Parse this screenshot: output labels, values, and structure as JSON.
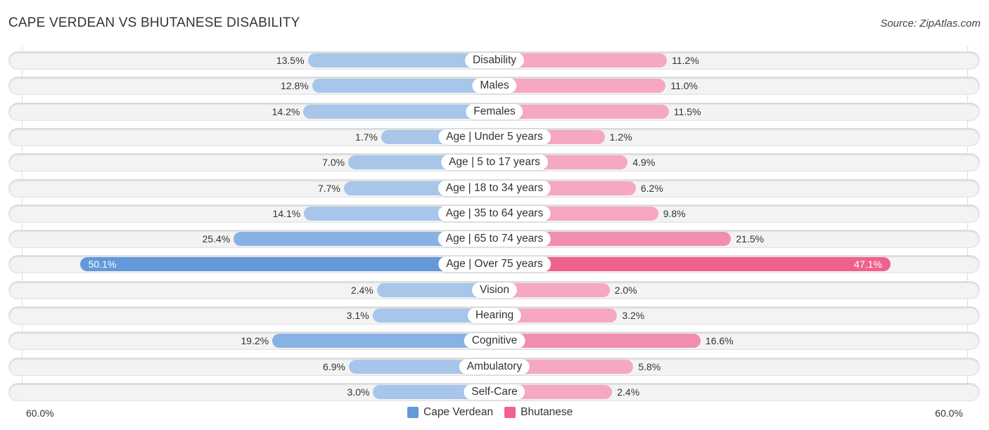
{
  "header": {
    "title": "CAPE VERDEAN VS BHUTANESE DISABILITY",
    "source": "Source: ZipAtlas.com"
  },
  "colors": {
    "cape_verdean": "#6399db",
    "bhutanese": "#f0628e"
  },
  "chart_data": {
    "type": "bar",
    "orientation": "horizontal-diverging",
    "title": "CAPE VERDEAN VS BHUTANESE DISABILITY",
    "xlabel": "",
    "ylabel": "",
    "xlim": [
      0,
      60
    ],
    "axis_min_label": "60.0%",
    "axis_max_label": "60.0%",
    "legend_position": "bottom-center",
    "categories": [
      "Disability",
      "Males",
      "Females",
      "Age | Under 5 years",
      "Age | 5 to 17 years",
      "Age | 18 to 34 years",
      "Age | 35 to 64 years",
      "Age | 65 to 74 years",
      "Age | Over 75 years",
      "Vision",
      "Hearing",
      "Cognitive",
      "Ambulatory",
      "Self-Care"
    ],
    "series": [
      {
        "name": "Cape Verdean",
        "side": "left",
        "values": [
          13.5,
          12.8,
          14.2,
          1.7,
          7.0,
          7.7,
          14.1,
          25.4,
          50.1,
          2.4,
          3.1,
          19.2,
          6.9,
          3.0
        ],
        "labels": [
          "13.5%",
          "12.8%",
          "14.2%",
          "1.7%",
          "7.0%",
          "7.7%",
          "14.1%",
          "25.4%",
          "50.1%",
          "2.4%",
          "3.1%",
          "19.2%",
          "6.9%",
          "3.0%"
        ]
      },
      {
        "name": "Bhutanese",
        "side": "right",
        "values": [
          11.2,
          11.0,
          11.5,
          1.2,
          4.9,
          6.2,
          9.8,
          21.5,
          47.1,
          2.0,
          3.2,
          16.6,
          5.8,
          2.4
        ],
        "labels": [
          "11.2%",
          "11.0%",
          "11.5%",
          "1.2%",
          "4.9%",
          "6.2%",
          "9.8%",
          "21.5%",
          "47.1%",
          "2.0%",
          "3.2%",
          "16.6%",
          "5.8%",
          "2.4%"
        ]
      }
    ]
  },
  "legend": {
    "items": [
      {
        "label": "Cape Verdean"
      },
      {
        "label": "Bhutanese"
      }
    ]
  },
  "axis": {
    "left_label": "60.0%",
    "right_label": "60.0%"
  }
}
